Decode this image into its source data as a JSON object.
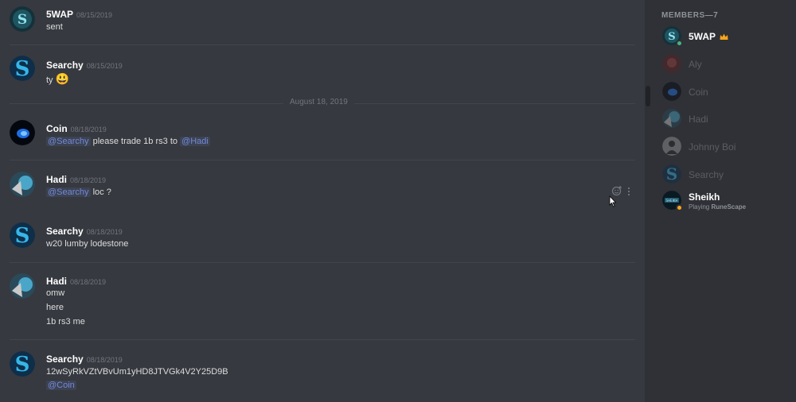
{
  "colors": {
    "background": "#36393f",
    "sidebar": "#2f3136",
    "mention": "#7289da",
    "online": "#43b581",
    "idle": "#faa61a",
    "crown": "#faa61a"
  },
  "chat": {
    "date_separator": "August 18, 2019",
    "messages": [
      {
        "author": "5WAP",
        "timestamp": "08/15/2019",
        "lines": [
          "sent"
        ]
      },
      {
        "author": "Searchy",
        "timestamp": "08/15/2019",
        "lines": [
          "ty"
        ],
        "emoji": "😃"
      },
      {
        "author": "Coin",
        "timestamp": "08/18/2019",
        "mention1": "@Searchy",
        "text": " please trade 1b rs3 to ",
        "mention2": "@Hadi"
      },
      {
        "author": "Hadi",
        "timestamp": "08/18/2019",
        "mention1": "@Searchy",
        "text": " loc ?"
      },
      {
        "author": "Searchy",
        "timestamp": "08/18/2019",
        "lines": [
          "w20 lumby lodestone"
        ]
      },
      {
        "author": "Hadi",
        "timestamp": "08/18/2019",
        "lines": [
          "omw",
          "here",
          "1b rs3 me"
        ]
      },
      {
        "author": "Searchy",
        "timestamp": "08/18/2019",
        "lines": [
          "12wSyRkVZtVBvUm1yHD8JTVGk4V2Y25D9B"
        ],
        "mention1": "@Coin"
      }
    ],
    "hover_actions": [
      "add-reaction-icon",
      "more-options-icon"
    ]
  },
  "members": {
    "header": "MEMBERS—7",
    "list": [
      {
        "name": "5WAP",
        "status": "online",
        "badge": "crown-icon"
      },
      {
        "name": "Aly",
        "status": "offline"
      },
      {
        "name": "Coin",
        "status": "offline"
      },
      {
        "name": "Hadi",
        "status": "offline"
      },
      {
        "name": "Johnny Boi",
        "status": "offline"
      },
      {
        "name": "Searchy",
        "status": "offline"
      },
      {
        "name": "Sheikh",
        "status": "idle",
        "activity_prefix": "Playing ",
        "activity_game": "RuneScape"
      }
    ]
  }
}
